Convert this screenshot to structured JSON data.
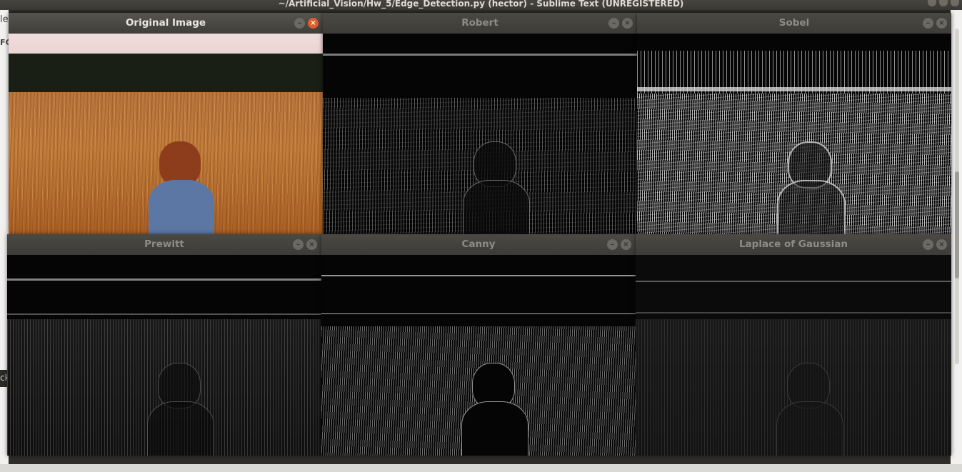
{
  "background_app": {
    "title": "~/Artificial_Vision/Hw_5/Edge_Detection.py (hector) - Sublime Text (UNREGISTERED)",
    "left_fragments": [
      "le",
      "FC",
      "ck"
    ]
  },
  "windows": [
    {
      "id": "original",
      "title": "Original Image",
      "active": true
    },
    {
      "id": "robert",
      "title": "Robert",
      "active": false
    },
    {
      "id": "sobel",
      "title": "Sobel",
      "active": false
    },
    {
      "id": "prewitt",
      "title": "Prewitt",
      "active": false
    },
    {
      "id": "canny",
      "title": "Canny",
      "active": false
    },
    {
      "id": "log",
      "title": "Laplace of Gaussian",
      "active": false
    }
  ],
  "buttons": {
    "minimize_glyph": "–",
    "close_glyph": "×"
  },
  "icons": {
    "minimize": "minimize-icon",
    "close": "close-icon"
  },
  "colors": {
    "close_active": "#e25c2e",
    "titlebar": "#3c3b37"
  }
}
